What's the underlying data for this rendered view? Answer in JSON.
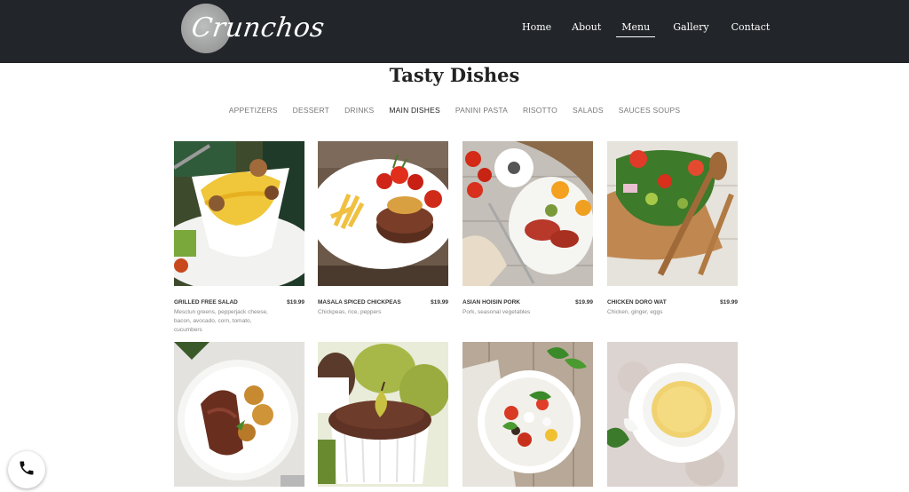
{
  "header": {
    "logo_text": "Crunchos",
    "nav": [
      {
        "label": "Home",
        "active": false
      },
      {
        "label": "About",
        "active": false
      },
      {
        "label": "Menu",
        "active": true
      },
      {
        "label": "Gallery",
        "active": false
      },
      {
        "label": "Contact",
        "active": false
      }
    ]
  },
  "main": {
    "title": "Tasty Dishes",
    "tabs": [
      {
        "label": "APPETIZERS",
        "active": false
      },
      {
        "label": "DESSERT",
        "active": false
      },
      {
        "label": "DRINKS",
        "active": false
      },
      {
        "label": "MAIN DISHES",
        "active": true
      },
      {
        "label": "PANINI PASTA",
        "active": false
      },
      {
        "label": "RISOTTO",
        "active": false
      },
      {
        "label": "SALADS",
        "active": false
      },
      {
        "label": "SAUCES SOUPS",
        "active": false
      }
    ],
    "dishes": [
      {
        "name": "GRILLED FREE SALAD",
        "price": "$19.99",
        "description": "Mesclun greens, pepperjack cheese, bacon, avocado, corn, tomato, cucumbers",
        "image": "pasta-with-mushrooms-photo"
      },
      {
        "name": "MASALA SPICED CHICKPEAS",
        "price": "$19.99",
        "description": "Chickpeas, rice, peppers",
        "image": "steak-with-fries-photo"
      },
      {
        "name": "ASIAN HOISIN PORK",
        "price": "$19.99",
        "description": "Pork, seasonal vegetables",
        "image": "breakfast-plate-photo"
      },
      {
        "name": "CHICKEN DORO WAT",
        "price": "$19.99",
        "description": "Chicken, ginger, eggs",
        "image": "salad-on-board-photo"
      },
      {
        "name": "",
        "price": "",
        "description": "",
        "image": "roast-meat-potatoes-photo"
      },
      {
        "name": "",
        "price": "",
        "description": "",
        "image": "chocolate-souffle-photo"
      },
      {
        "name": "",
        "price": "",
        "description": "",
        "image": "caprese-salad-bowl-photo"
      },
      {
        "name": "",
        "price": "",
        "description": "",
        "image": "cup-of-soup-photo"
      }
    ]
  },
  "phone_button": {
    "icon": "phone-icon"
  },
  "colors": {
    "header_bg": "#222529",
    "nav_text": "#ffffff",
    "tab_inactive": "#777777",
    "tab_active": "#222222"
  }
}
